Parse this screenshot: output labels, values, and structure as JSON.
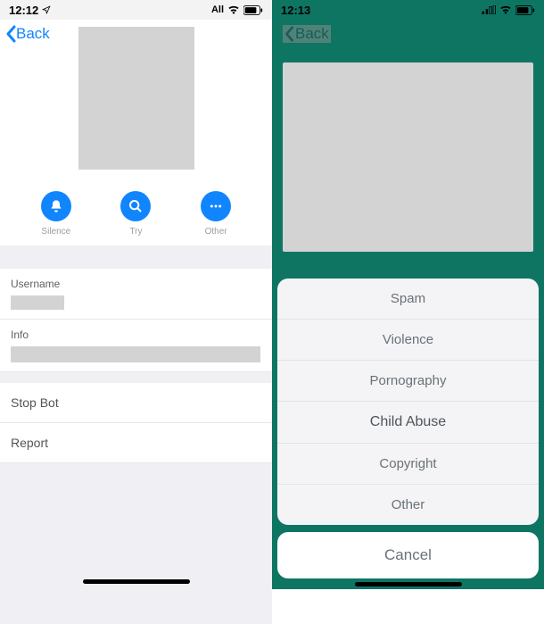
{
  "left": {
    "status": {
      "time": "12:12",
      "carrier_text": "All"
    },
    "back_label": "Back",
    "actions": {
      "silence": "Silence",
      "try": "Try",
      "other": "Other"
    },
    "username_label": "Username",
    "info_label": "Info",
    "stop_bot": "Stop Bot",
    "report": "Report"
  },
  "right": {
    "status": {
      "time": "12:13"
    },
    "back_label": "Back",
    "sheet": {
      "spam": "Spam",
      "violence": "Violence",
      "pornography": "Pornography",
      "child_abuse": "Child Abuse",
      "copyright": "Copyright",
      "other": "Other"
    },
    "cancel": "Cancel"
  }
}
